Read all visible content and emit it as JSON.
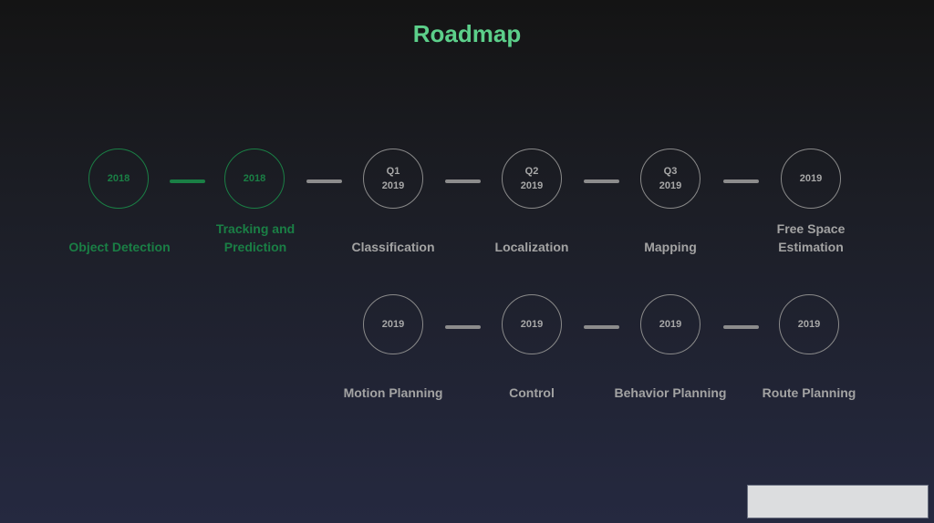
{
  "title": "Roadmap",
  "row1": [
    {
      "line1": "",
      "line2": "2018",
      "label": "Object Detection",
      "status": "done"
    },
    {
      "line1": "",
      "line2": "2018",
      "label": "Tracking and Prediction",
      "status": "done"
    },
    {
      "line1": "Q1",
      "line2": "2019",
      "label": "Classification",
      "status": "pending"
    },
    {
      "line1": "Q2",
      "line2": "2019",
      "label": "Localization",
      "status": "pending"
    },
    {
      "line1": "Q3",
      "line2": "2019",
      "label": "Mapping",
      "status": "pending"
    },
    {
      "line1": "",
      "line2": "2019",
      "label": "Free Space Estimation",
      "status": "pending"
    }
  ],
  "row2": [
    {
      "line1": "",
      "line2": "2019",
      "label": "Motion Planning",
      "status": "pending"
    },
    {
      "line1": "",
      "line2": "2019",
      "label": "Control",
      "status": "pending"
    },
    {
      "line1": "",
      "line2": "2019",
      "label": "Behavior Planning",
      "status": "pending"
    },
    {
      "line1": "",
      "line2": "2019",
      "label": "Route Planning",
      "status": "pending"
    }
  ],
  "colors": {
    "done": "#1a7f45",
    "pending": "#a3a3a3",
    "title": "#5ccf8a"
  }
}
